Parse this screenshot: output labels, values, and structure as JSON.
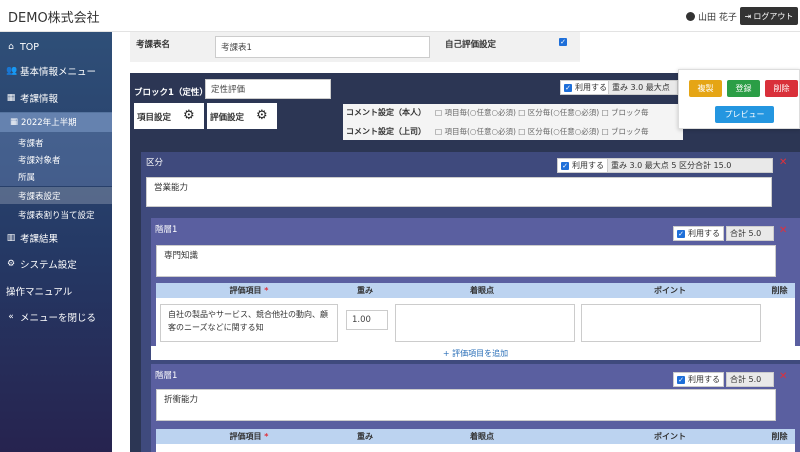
{
  "header": {
    "company": "DEMO株式会社",
    "user_name": "山田 花子",
    "logout_label": "ログアウト"
  },
  "sidebar": {
    "items": [
      {
        "label": "TOP",
        "icon": "home-icon"
      },
      {
        "label": "基本情報メニュー",
        "icon": "users-icon"
      },
      {
        "label": "考課情報",
        "icon": "table-icon"
      },
      {
        "label": "考課結果",
        "icon": "chart-icon"
      },
      {
        "label": "システム設定",
        "icon": "gear-icon"
      },
      {
        "label": "操作マニュアル",
        "icon": ""
      },
      {
        "label": "メニューを閉じる",
        "icon": "double-chevron-left-icon"
      }
    ],
    "term": "2022年上半期",
    "sub_items": [
      "考課者",
      "考課対象者",
      "所属",
      "考課表設定",
      "考課表割り当て設定"
    ]
  },
  "form": {
    "sheet_name_label": "考課表名",
    "sheet_name_value": "考課表1",
    "self_eval_label": "自己評価設定"
  },
  "block": {
    "title": "ブロック1（定性）",
    "name_value": "定性評価",
    "use_label": "利用する",
    "weight_text": "重み 3.0 最大点",
    "item_settings": "項目設定",
    "eval_settings": "評価設定",
    "comment_self": "コメント設定（本人）",
    "comment_boss": "コメント設定（上司）",
    "comment_options": "□ 項目毎(○任意○必須)  □ 区分毎(○任意○必須)  □ ブロック毎"
  },
  "actions": {
    "copy": "複製",
    "register": "登録",
    "delete": "削除",
    "preview": "プレビュー"
  },
  "section": {
    "title": "区分",
    "use_label": "利用する",
    "weight_text": "重み 3.0 最大点 5 区分合計 15.0",
    "name_value": "営業能力"
  },
  "layers": [
    {
      "title": "階層1",
      "use_label": "利用する",
      "total_text": "合計 5.0",
      "name_value": "専門知識",
      "headers": [
        "評価項目",
        "重み",
        "着眼点",
        "ポイント",
        "削除"
      ],
      "row_text": "自社の製品やサービス、競合他社の動向、顧客のニーズなどに関する知",
      "row_weight": "1.00",
      "add_label": "+ 評価項目を追加"
    },
    {
      "title": "階層1",
      "use_label": "利用する",
      "total_text": "合計 5.0",
      "name_value": "折衝能力",
      "headers": [
        "評価項目",
        "重み",
        "着眼点",
        "ポイント",
        "削除"
      ]
    }
  ]
}
